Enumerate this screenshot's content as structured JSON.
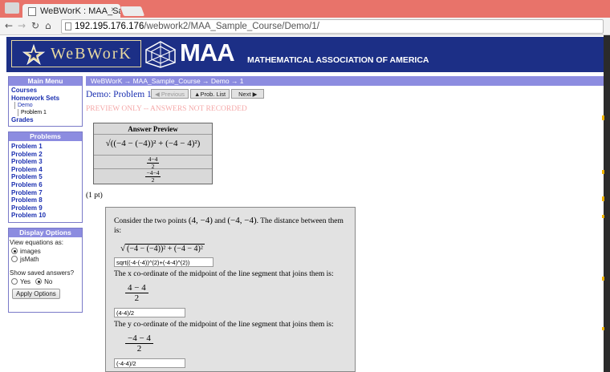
{
  "browser": {
    "tab_title": "WeBWorK : MAA_Sa",
    "tab_close": "×",
    "url_host": "192.195.176.176",
    "url_path": "/webwork2/MAA_Sample_Course/Demo/1/"
  },
  "banner": {
    "webwork_logo": "WeBWorK",
    "maa_logo": "MAA",
    "maa_subtitle": "MATHEMATICAL ASSOCIATION OF AMERICA",
    "colors": {
      "banner_bg": "#1c2f86",
      "logo_text": "#e8d9a0"
    }
  },
  "main_menu": {
    "title": "Main Menu",
    "courses": "Courses",
    "homework_sets": "Homework Sets",
    "demo": "Demo",
    "problem1": "Problem 1",
    "grades": "Grades"
  },
  "problems_menu": {
    "title": "Problems",
    "items": [
      "Problem 1",
      "Problem 2",
      "Problem 3",
      "Problem 4",
      "Problem 5",
      "Problem 6",
      "Problem 7",
      "Problem 8",
      "Problem 9",
      "Problem 10"
    ]
  },
  "display_options": {
    "title": "Display Options",
    "view_label": "View equations as:",
    "opt_images": "images",
    "opt_jsmath": "jsMath",
    "selected_view": "images",
    "show_saved_label": "Show saved answers?",
    "opt_yes": "Yes",
    "opt_no": "No",
    "selected_saved": "No",
    "apply_label": "Apply Options"
  },
  "breadcrumb": "WeBWorK → MAA_Sample_Course → Demo → 1",
  "page": {
    "title": "Demo: Problem 1",
    "prev_label": "◀ Previous",
    "list_label": "▲Prob. List",
    "next_label": "Next ▶",
    "preview_notice": "PREVIEW ONLY -- ANSWERS NOT RECORDED",
    "points": "(1 pt)"
  },
  "answer_preview": {
    "header": "Answer Preview",
    "row1": "√((−4 − (−4))² + (−4 − 4)²)",
    "row2_num": "4−4",
    "row2_den": "2",
    "row3_num": "−4−4",
    "row3_den": "2"
  },
  "problem": {
    "intro_pre": "Consider the two points ",
    "point_a": "(4, −4)",
    "intro_and": " and ",
    "point_b": "(−4, −4)",
    "intro_post": ". The distance between them is:",
    "distance_expr": "(−4 − (−4))² + (−4 − 4)²",
    "answer1": "sqrt((-4-(-4))^(2)+(-4-4)^(2))",
    "x_prompt": "The x co-ordinate of the midpoint of the line segment that joins them is:",
    "x_num": "4 − 4",
    "x_den": "2",
    "answer2": "(4-4)/2",
    "y_prompt": "The y co-ordinate of the midpoint of the line segment that joins them is:",
    "y_num": "−4 − 4",
    "y_den": "2",
    "answer3": "(-4-4)/2"
  }
}
